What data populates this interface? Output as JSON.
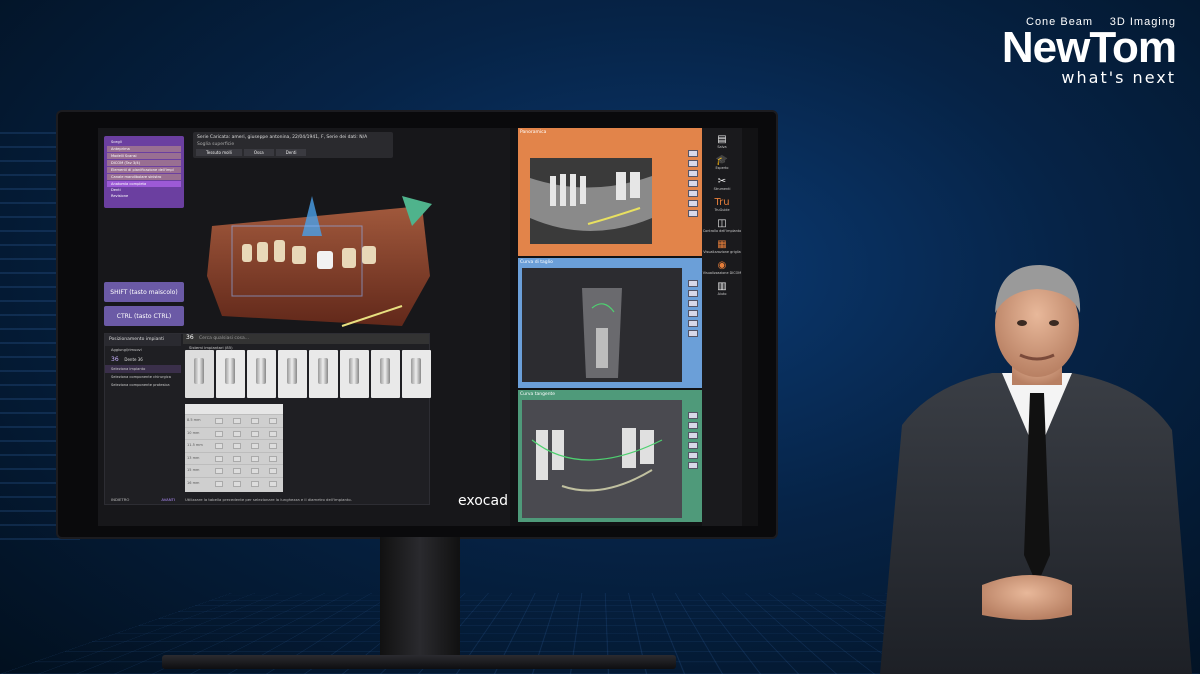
{
  "brand": {
    "tag_left": "Cone Beam",
    "tag_right": "3D Imaging",
    "logo": "NewTom",
    "tagline": "what's next"
  },
  "app": {
    "name": "exocad",
    "patient_title": "Serie Caricata: ameri, giuseppe antonina, 22/04/1941, F, Serie dei dati: N/A",
    "surface_label": "Soglia superficie",
    "view_buttons": [
      "Tessuto molli",
      "Ossa",
      "Denti"
    ],
    "steps": [
      {
        "label": "Scegli",
        "type": "head"
      },
      {
        "label": "Anteprima",
        "type": "sub"
      },
      {
        "label": "Modelli Scansi",
        "type": "sub"
      },
      {
        "label": "DICOM (Tav 3/4)",
        "type": "sub"
      },
      {
        "label": "Elementi di pianificazione dell'impl",
        "type": "sub"
      },
      {
        "label": "Canale mandibolare sinistro",
        "type": "sub"
      },
      {
        "label": "Anatomia completa",
        "type": "hl"
      },
      {
        "label": "Denti",
        "type": "head"
      },
      {
        "label": "Revisione",
        "type": "head"
      }
    ],
    "key_shift": "SHIFT (tasto maiscolo)",
    "key_ctrl": "CTRL (tasto CTRL)",
    "implant_panel": {
      "title": "Posizionamento impianti",
      "tooth_number": "36",
      "tooth_label": "Dente 36",
      "search_placeholder": "Cerca qualsiasi cosa...",
      "library_title": "Sistemi impiantari (85)",
      "actions": [
        "Aggiungi/rimuovi",
        "Seleziona impianto",
        "Seleziona componente chirurgica",
        "Seleziona componente protesica"
      ],
      "back": "INDIETRO",
      "next": "AVANTI",
      "hint": "Utilizzare la tabella precedente per selezionare la lunghezza e il diametro dell'impianto.",
      "lengths": [
        "8.5 mm",
        "10 mm",
        "11.5 mm",
        "13 mm",
        "15 mm",
        "16 mm"
      ]
    },
    "views": {
      "pano": "Panoramica",
      "cut": "Curva di taglio",
      "tangent": "Curva tangente"
    },
    "sidebar": [
      {
        "icon": "save-icon",
        "glyph": "▤",
        "label": "Salva",
        "color": "#eeeeee"
      },
      {
        "icon": "expert-icon",
        "glyph": "🎓",
        "label": "Esperto",
        "color": "#eeeeee"
      },
      {
        "icon": "tools-icon",
        "glyph": "✂",
        "label": "Strumenti",
        "color": "#eeeeee"
      },
      {
        "icon": "trulabs-icon",
        "glyph": "Tru",
        "label": "TruGuide",
        "color": "#e67e3a"
      },
      {
        "icon": "implant-control-icon",
        "glyph": "◫",
        "label": "Controllo dell'impianto",
        "color": "#eeeeee"
      },
      {
        "icon": "pano-view-icon",
        "glyph": "▦",
        "label": "Visualizzazione griglia",
        "color": "#e67e3a"
      },
      {
        "icon": "dicom-view-icon",
        "glyph": "◉",
        "label": "Visualizzazione DICOM",
        "color": "#e67e3a"
      },
      {
        "icon": "help-icon",
        "glyph": "▥",
        "label": "Aiuto",
        "color": "#eeeeee"
      }
    ]
  },
  "colors": {
    "accent_purple": "#6b3fa0",
    "pano_frame": "#e2844a",
    "cut_frame": "#6b9fd8",
    "tangent_frame": "#4f9a7a"
  }
}
